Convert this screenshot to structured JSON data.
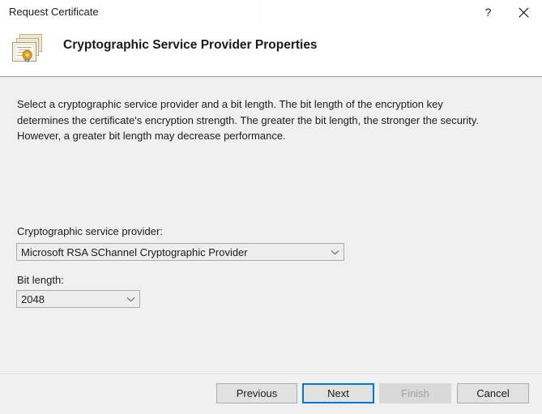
{
  "window": {
    "title": "Request Certificate",
    "help_label": "?",
    "close_label": "×"
  },
  "header": {
    "title": "Cryptographic Service Provider Properties",
    "icon": "certificate-stack-icon"
  },
  "main": {
    "description": "Select a cryptographic service provider and a bit length. The bit length of the encryption key determines the certificate's encryption strength. The greater the bit length, the stronger the security. However, a greater bit length may decrease performance.",
    "csp_field": {
      "label": "Cryptographic service provider:",
      "value": "Microsoft RSA SChannel Cryptographic Provider",
      "arrow_icon": "chevron-down-icon"
    },
    "bitlength_field": {
      "label": "Bit length:",
      "value": "2048",
      "arrow_icon": "chevron-down-icon"
    }
  },
  "footer": {
    "previous_label": "Previous",
    "next_label": "Next",
    "finish_label": "Finish",
    "cancel_label": "Cancel"
  },
  "colors": {
    "window_background": "#f0f0f0",
    "titlebar_background": "#ffffff",
    "focus_accent": "#0078d7",
    "button_face": "#e1e1e1",
    "button_border": "#adadad",
    "disabled_text": "#a0a0a0",
    "rule": "#9a9a9a"
  }
}
